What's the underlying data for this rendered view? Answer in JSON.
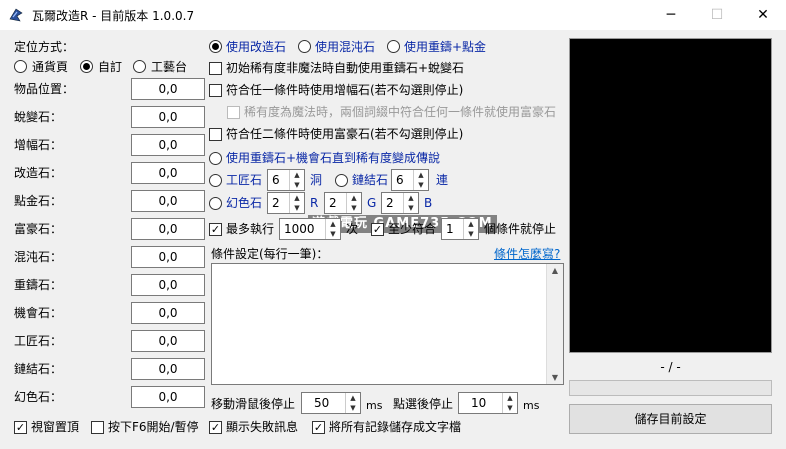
{
  "window": {
    "title": "瓦爾改造R - 目前版本 1.0.0.7",
    "minimize": "─",
    "maximize": "☐",
    "close": "✕"
  },
  "left": {
    "position_mode_label": "定位方式：",
    "position_modes": [
      "通貨頁",
      "自訂",
      "工藝台"
    ],
    "selected_mode": 1,
    "fields": [
      {
        "label": "物品位置：",
        "value": "0,0"
      },
      {
        "label": "蛻變石：",
        "value": "0,0"
      },
      {
        "label": "增幅石：",
        "value": "0,0"
      },
      {
        "label": "改造石：",
        "value": "0,0"
      },
      {
        "label": "點金石：",
        "value": "0,0"
      },
      {
        "label": "富豪石：",
        "value": "0,0"
      },
      {
        "label": "混沌石：",
        "value": "0,0"
      },
      {
        "label": "重鑄石：",
        "value": "0,0"
      },
      {
        "label": "機會石：",
        "value": "0,0"
      },
      {
        "label": "工匠石：",
        "value": "0,0"
      },
      {
        "label": "鏈結石：",
        "value": "0,0"
      },
      {
        "label": "幻色石：",
        "value": "0,0"
      }
    ]
  },
  "middle": {
    "use_modes": [
      "使用改造石",
      "使用混沌石",
      "使用重鑄+點金"
    ],
    "selected_use": 0,
    "opt_auto_scour": "初始稀有度非魔法時自動使用重鑄石+蛻變石",
    "opt_aug": "符合任一條件時使用增幅石(若不勾選則停止)",
    "opt_rare_sub": "稀有度為魔法時，兩個詞綴中符合任何一條件就使用富豪石",
    "opt_regal": "符合任二條件時使用富豪石(若不勾選則停止)",
    "opt_chance": "使用重鑄石+機會石直到稀有度變成傳說",
    "jeweller_label": "工匠石",
    "jeweller_value": "6",
    "jeweller_unit": "洞",
    "fusing_label": "鏈結石",
    "fusing_value": "6",
    "fusing_unit": "連",
    "chromatic_label": "幻色石",
    "r_value": "2",
    "r_label": "R",
    "g_value": "2",
    "g_label": "G",
    "b_value": "2",
    "b_label": "B",
    "max_exec_label": "最多執行",
    "max_exec_value": "1000",
    "max_exec_unit": "次",
    "match_label": "至少符合",
    "match_value": "1",
    "match_unit": "個條件就停止",
    "watermark": "遊戲電玩 GAME735.COM",
    "cond_label": "條件設定(每行一筆)：",
    "cond_link": "條件怎麼寫?",
    "cond_text": "",
    "stop_move_label": "移動滑鼠後停止",
    "stop_move_value": "50",
    "stop_move_unit": "ms",
    "stop_click_label": "點選後停止",
    "stop_click_value": "10",
    "stop_click_unit": "ms"
  },
  "right": {
    "status": "- / -",
    "save_button": "儲存目前設定"
  },
  "bottom": [
    {
      "label": "視窗置頂",
      "checked": true
    },
    {
      "label": "按下F6開始/暫停",
      "checked": false
    },
    {
      "label": "顯示失敗訊息",
      "checked": true
    },
    {
      "label": "將所有記錄儲存成文字檔",
      "checked": true
    }
  ]
}
